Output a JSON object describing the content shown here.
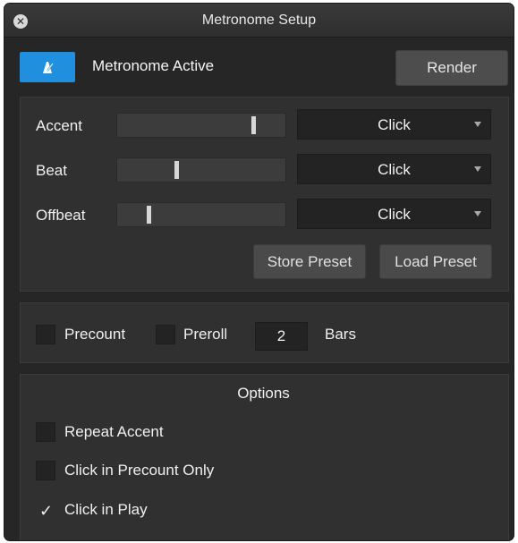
{
  "window": {
    "title": "Metronome Setup"
  },
  "header": {
    "active_label": "Metronome Active",
    "active_on": true,
    "render_label": "Render",
    "accent_color": "#1f8fde"
  },
  "sounds": {
    "rows": [
      {
        "label": "Accent",
        "level": 0.82,
        "sound": "Click"
      },
      {
        "label": "Beat",
        "level": 0.35,
        "sound": "Click"
      },
      {
        "label": "Offbeat",
        "level": 0.18,
        "sound": "Click"
      }
    ],
    "store_preset_label": "Store Preset",
    "load_preset_label": "Load Preset"
  },
  "count": {
    "precount_label": "Precount",
    "precount_checked": false,
    "preroll_label": "Preroll",
    "preroll_checked": false,
    "bars_value": "2",
    "bars_label": "Bars"
  },
  "options": {
    "title": "Options",
    "items": [
      {
        "label": "Repeat Accent",
        "checked": false
      },
      {
        "label": "Click in Precount Only",
        "checked": false
      },
      {
        "label": "Click in Play",
        "checked": true
      }
    ]
  },
  "icons": {
    "close": "close-icon",
    "metronome": "metronome-icon",
    "dropdown": "chevron-down-icon",
    "checkmark": "checkmark-icon"
  }
}
